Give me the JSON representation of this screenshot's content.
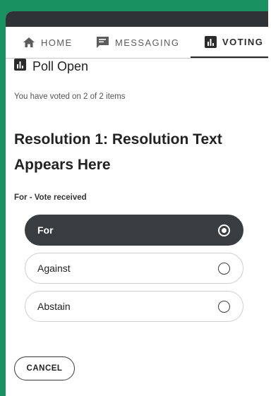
{
  "nav": {
    "tabs": [
      {
        "label": "HOME",
        "icon": "home-icon"
      },
      {
        "label": "MESSAGING",
        "icon": "chat-icon"
      },
      {
        "label": "VOTING",
        "icon": "poll-icon",
        "active": true
      }
    ]
  },
  "poll": {
    "status_title": "Poll Open",
    "voted_count": "You have voted on 2 of 2 items"
  },
  "resolution": {
    "title": "Resolution 1: Resolution Text Appears Here",
    "vote_status": "For - Vote received",
    "options": [
      {
        "label": "For",
        "selected": true
      },
      {
        "label": "Against",
        "selected": false
      },
      {
        "label": "Abstain",
        "selected": false
      }
    ]
  },
  "actions": {
    "cancel_label": "CANCEL"
  },
  "colors": {
    "frame": "#1a9160",
    "topbar": "#2f3335",
    "selected_option": "#3a3d3f"
  }
}
